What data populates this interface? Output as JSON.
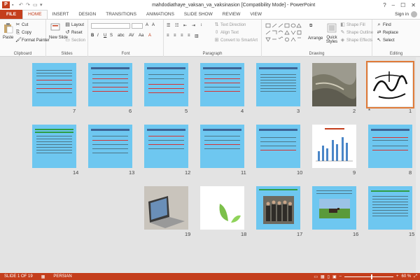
{
  "window": {
    "title": "mahdodiathaye_vaksan_va_vaksinasion [Compatibility Mode] - PowerPoint",
    "controls": [
      "?",
      "–",
      "☐",
      "✕"
    ]
  },
  "tabs": [
    "FILE",
    "HOME",
    "INSERT",
    "DESIGN",
    "TRANSITIONS",
    "ANIMATIONS",
    "SLIDE SHOW",
    "REVIEW",
    "VIEW"
  ],
  "sign_in": "Sign in",
  "ribbon": {
    "clipboard": {
      "label": "Clipboard",
      "paste": "Paste",
      "cut": "Cut",
      "copy": "Copy",
      "format_painter": "Format Painter"
    },
    "slides": {
      "label": "Slides",
      "new_slide": "New Slide",
      "layout": "Layout",
      "reset": "Reset",
      "section": "Section"
    },
    "font": {
      "label": "Font"
    },
    "paragraph": {
      "label": "Paragraph",
      "text_direction": "Text Direction",
      "align_text": "Align Text",
      "convert": "Convert to SmartArt"
    },
    "drawing": {
      "label": "Drawing",
      "arrange": "Arrange",
      "quick_styles": "Quick Styles",
      "shape_fill": "Shape Fill",
      "shape_outline": "Shape Outline",
      "shape_effects": "Shape Effects"
    },
    "editing": {
      "label": "Editing",
      "find": "Find",
      "replace": "Replace",
      "select": "Select"
    }
  },
  "slides": {
    "row1": [
      "7",
      "6",
      "5",
      "4",
      "3",
      "2",
      "1"
    ],
    "row2": [
      "14",
      "13",
      "12",
      "11",
      "10",
      "9",
      "8"
    ],
    "row3": [
      "19",
      "18",
      "17",
      "16",
      "15"
    ],
    "selected": "1",
    "transition_marker": "*"
  },
  "status": {
    "slide_info": "SLIDE 1 OF 19",
    "language": "PERSIAN",
    "zoom": "60 %"
  },
  "colors": {
    "accent": "#c43e1c",
    "slide_bg": "#6ec7f0",
    "selection": "#e07b39"
  }
}
